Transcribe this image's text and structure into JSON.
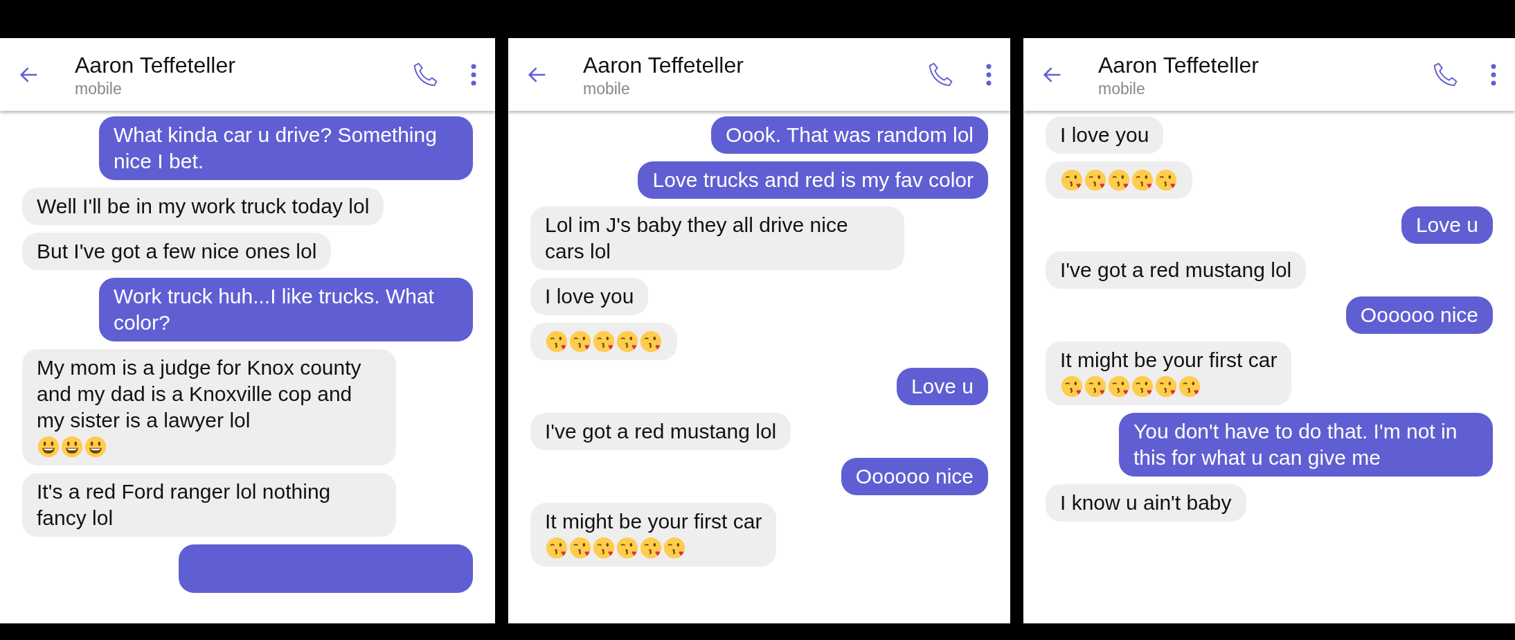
{
  "panels": [
    {
      "contact": {
        "name": "Aaron Teffeteller",
        "subtitle": "mobile"
      },
      "messages": [
        {
          "kind": "sent",
          "text": "What kinda car u drive? Something nice I bet."
        },
        {
          "kind": "received",
          "text": "Well I'll be in my work truck today lol"
        },
        {
          "kind": "received",
          "text": "But I've got a few nice ones lol"
        },
        {
          "kind": "sent",
          "text": "Work truck huh...I like trucks. What color?"
        },
        {
          "kind": "received",
          "text": "My mom is a judge for Knox county and my dad is a Knoxville cop and my sister is a lawyer lol",
          "emoji": [
            {
              "kind": "grin"
            },
            {
              "kind": "grin"
            },
            {
              "kind": "grin"
            }
          ]
        },
        {
          "kind": "received",
          "text": "It's a red Ford ranger lol nothing fancy lol"
        },
        {
          "kind": "sent"
        }
      ]
    },
    {
      "contact": {
        "name": "Aaron Teffeteller",
        "subtitle": "mobile"
      },
      "messages": [
        {
          "kind": "sent",
          "text": "Oook. That was random lol"
        },
        {
          "kind": "sent",
          "text": "Love trucks and red is my fav color"
        },
        {
          "kind": "received",
          "text": "Lol im J's baby they all drive nice cars lol"
        },
        {
          "kind": "received",
          "text": "I love you"
        },
        {
          "kind": "received",
          "emoji": [
            {
              "kind": "kiss"
            },
            {
              "kind": "kiss"
            },
            {
              "kind": "kiss"
            },
            {
              "kind": "kiss"
            },
            {
              "kind": "kiss"
            }
          ]
        },
        {
          "kind": "sent",
          "text": "Love u"
        },
        {
          "kind": "received",
          "text": "I've got a red mustang lol"
        },
        {
          "kind": "sent",
          "text": "Oooooo nice"
        },
        {
          "kind": "received",
          "text": "It might be your first car",
          "emoji": [
            {
              "kind": "kiss"
            },
            {
              "kind": "kiss"
            },
            {
              "kind": "kiss"
            },
            {
              "kind": "kiss"
            },
            {
              "kind": "kiss"
            },
            {
              "kind": "kiss"
            }
          ]
        }
      ]
    },
    {
      "contact": {
        "name": "Aaron Teffeteller",
        "subtitle": "mobile"
      },
      "messages": [
        {
          "kind": "received",
          "text": "I love you"
        },
        {
          "kind": "received",
          "emoji": [
            {
              "kind": "kiss"
            },
            {
              "kind": "kiss"
            },
            {
              "kind": "kiss"
            },
            {
              "kind": "kiss"
            },
            {
              "kind": "kiss"
            }
          ]
        },
        {
          "kind": "sent",
          "text": "Love u"
        },
        {
          "kind": "received",
          "text": "I've got a red mustang lol"
        },
        {
          "kind": "sent",
          "text": "Oooooo nice"
        },
        {
          "kind": "received",
          "text": "It might be your first car",
          "emoji": [
            {
              "kind": "kiss"
            },
            {
              "kind": "kiss"
            },
            {
              "kind": "kiss"
            },
            {
              "kind": "kiss"
            },
            {
              "kind": "kiss"
            },
            {
              "kind": "kiss"
            }
          ]
        },
        {
          "kind": "sent",
          "text": "You don't have to do that. I'm not in this for what u can give me"
        },
        {
          "kind": "received",
          "text": "I know u ain't baby"
        }
      ]
    }
  ]
}
